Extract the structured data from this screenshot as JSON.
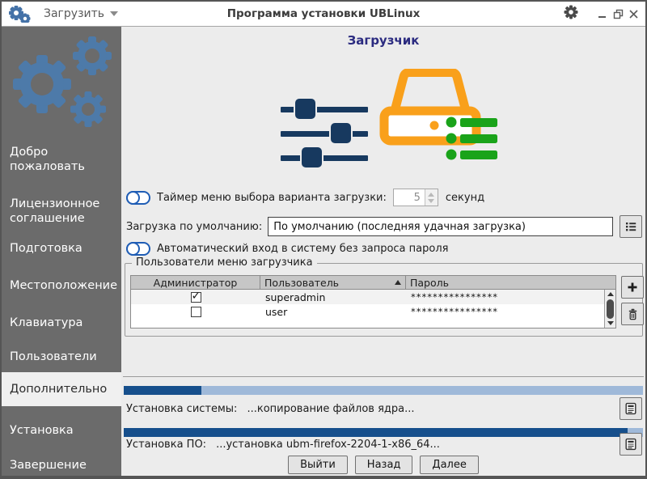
{
  "window": {
    "menu_label": "Загрузить",
    "title": "Программа установки UBLinux"
  },
  "sidebar": {
    "items": [
      {
        "label": "Добро пожаловать",
        "active": false
      },
      {
        "label": "Лицензионное соглашение",
        "active": false
      },
      {
        "label": "Подготовка",
        "active": false
      },
      {
        "label": "Местоположение",
        "active": false
      },
      {
        "label": "Клавиатура",
        "active": false
      },
      {
        "label": "Пользователи",
        "active": false
      },
      {
        "label": "Дополнительно",
        "active": true
      },
      {
        "label": "Установка",
        "active": false
      },
      {
        "label": "Завершение",
        "active": false
      }
    ]
  },
  "main": {
    "page_title": "Загрузчик",
    "timer": {
      "label": "Таймер меню выбора варианта загрузки:",
      "value": "5",
      "unit": "секунд"
    },
    "default_boot": {
      "label": "Загрузка по умолчанию:",
      "value": "По умолчанию (последняя удачная загрузка)"
    },
    "autologin": {
      "label": "Автоматический вход в систему без запроса пароля"
    },
    "users_group": {
      "legend": "Пользователи меню загрузчика",
      "table": {
        "columns": [
          "Администратор",
          "Пользователь",
          "Пароль"
        ],
        "sorted_by": "Пользователь",
        "sort_direction": "asc",
        "rows": [
          {
            "admin": true,
            "user": "superadmin",
            "password": "****************"
          },
          {
            "admin": false,
            "user": "user",
            "password": "****************"
          }
        ]
      }
    },
    "progress": [
      {
        "label": "Установка системы:",
        "status": "...копирование файлов ядра...",
        "percent": 15
      },
      {
        "label": "Установка ПО:",
        "status": "...установка ubm-firefox-2204-1-x86_64...",
        "percent": 97
      }
    ],
    "footer": {
      "exit": "Выйти",
      "back": "Назад",
      "next": "Далее"
    }
  },
  "colors": {
    "accent_blue": "#1f5db5",
    "gear_blue": "#4d7aa9",
    "icon_navy": "#17395f",
    "icon_orange": "#f9a01b",
    "icon_green": "#1aa31a",
    "progress_dark": "#164f8c",
    "progress_light": "#9fb9d9",
    "sidebar_gray": "#6b6b6b",
    "title_navy": "#2b2b80"
  }
}
